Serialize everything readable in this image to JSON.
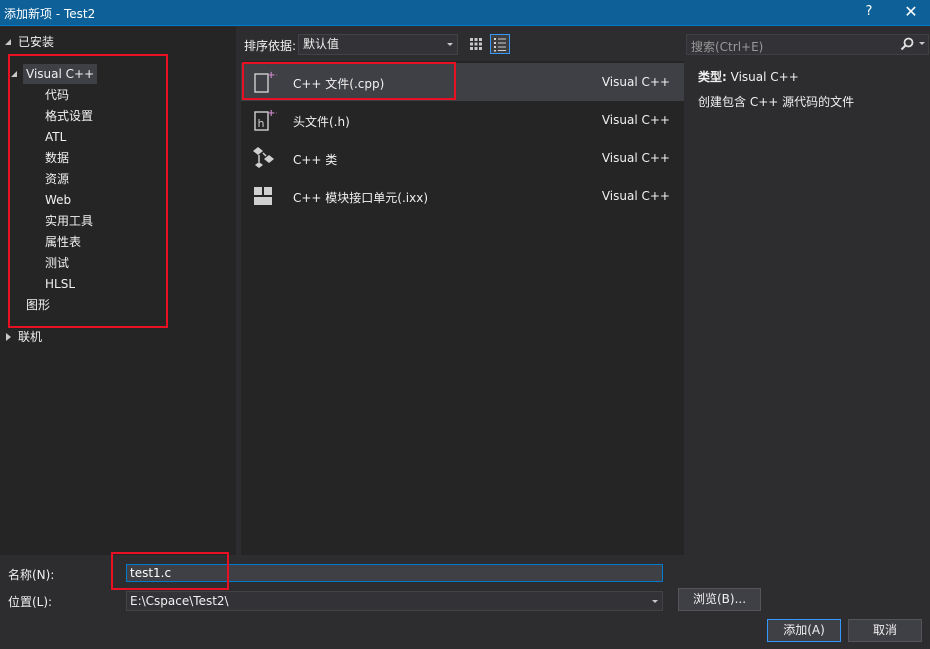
{
  "window": {
    "title": "添加新项 - Test2",
    "help_label": "?",
    "close_label": "✕"
  },
  "tree": {
    "installed": "已安装",
    "visual_cpp": "Visual C++",
    "children": [
      "代码",
      "格式设置",
      "ATL",
      "数据",
      "资源",
      "Web",
      "实用工具",
      "属性表",
      "测试",
      "HLSL"
    ],
    "graphics": "图形",
    "online": "联机"
  },
  "toolbar": {
    "sort_label": "排序依据:",
    "sort_value": "默认值"
  },
  "templates": [
    {
      "name": "C++ 文件(.cpp)",
      "lang": "Visual C++",
      "icon": "cpp-file-icon"
    },
    {
      "name": "头文件(.h)",
      "lang": "Visual C++",
      "icon": "header-file-icon"
    },
    {
      "name": "C++ 类",
      "lang": "Visual C++",
      "icon": "cpp-class-icon"
    },
    {
      "name": "C++ 模块接口单元(.ixx)",
      "lang": "Visual C++",
      "icon": "module-interface-icon"
    }
  ],
  "details": {
    "search_placeholder": "搜索(Ctrl+E)",
    "type_label": "类型:",
    "type_value": "Visual C++",
    "description": "创建包含 C++ 源代码的文件"
  },
  "form": {
    "name_label": "名称(N):",
    "name_value": "test1.c",
    "location_label": "位置(L):",
    "location_value": "E:\\Cspace\\Test2\\",
    "browse_label": "浏览(B)...",
    "add_label": "添加(A)",
    "cancel_label": "取消"
  },
  "colors": {
    "titlebar": "#0e6198",
    "accent": "#007acc",
    "highlight_box": "#e81123",
    "icon_plus": "#c586c0"
  }
}
